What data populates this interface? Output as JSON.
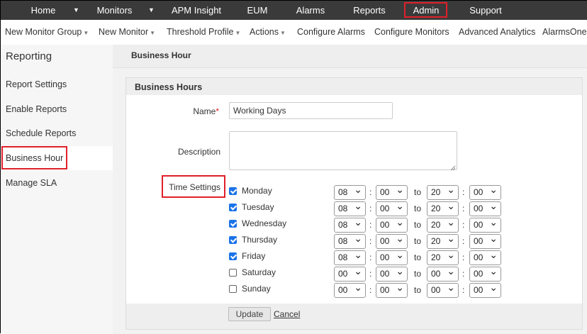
{
  "topnav": {
    "home": "Home",
    "monitors": "Monitors",
    "apm": "APM Insight",
    "eum": "EUM",
    "alarms": "Alarms",
    "reports": "Reports",
    "admin": "Admin",
    "support": "Support"
  },
  "subnav": {
    "new_monitor_group": "New Monitor Group",
    "new_monitor": "New Monitor",
    "threshold_profile": "Threshold Profile",
    "actions": "Actions",
    "configure_alarms": "Configure Alarms",
    "configure_monitors": "Configure Monitors",
    "advanced_analytics": "Advanced Analytics",
    "alarmsone": "AlarmsOne"
  },
  "sidebar": {
    "title": "Reporting",
    "items": [
      "Report Settings",
      "Enable Reports",
      "Schedule Reports",
      "Business Hour",
      "Manage SLA"
    ]
  },
  "page": {
    "header": "Business Hour",
    "panel_title": "Business Hours"
  },
  "form": {
    "name_label": "Name",
    "required_mark": "*",
    "name_value": "Working Days",
    "description_label": "Description",
    "description_value": "",
    "time_settings_label": "Time Settings",
    "to_label": "to",
    "colon": ":",
    "days": [
      {
        "name": "Monday",
        "checked": true,
        "sh": "08",
        "sm": "00",
        "eh": "20",
        "em": "00"
      },
      {
        "name": "Tuesday",
        "checked": true,
        "sh": "08",
        "sm": "00",
        "eh": "20",
        "em": "00"
      },
      {
        "name": "Wednesday",
        "checked": true,
        "sh": "08",
        "sm": "00",
        "eh": "20",
        "em": "00"
      },
      {
        "name": "Thursday",
        "checked": true,
        "sh": "08",
        "sm": "00",
        "eh": "20",
        "em": "00"
      },
      {
        "name": "Friday",
        "checked": true,
        "sh": "08",
        "sm": "00",
        "eh": "20",
        "em": "00"
      },
      {
        "name": "Saturday",
        "checked": false,
        "sh": "00",
        "sm": "00",
        "eh": "00",
        "em": "00"
      },
      {
        "name": "Sunday",
        "checked": false,
        "sh": "00",
        "sm": "00",
        "eh": "00",
        "em": "00"
      }
    ],
    "update_button": "Update",
    "cancel_link": "Cancel"
  },
  "colors": {
    "nav_bg": "#3a3a3a",
    "highlight": "#e0202a",
    "checkbox": "#1a73e8"
  }
}
